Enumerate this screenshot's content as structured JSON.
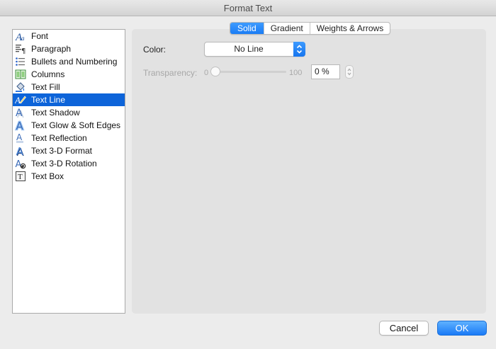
{
  "window": {
    "title": "Format Text"
  },
  "sidebar": {
    "items": [
      {
        "label": "Font",
        "icon": "font-icon",
        "selected": false
      },
      {
        "label": "Paragraph",
        "icon": "paragraph-icon",
        "selected": false
      },
      {
        "label": "Bullets and Numbering",
        "icon": "bullets-icon",
        "selected": false
      },
      {
        "label": "Columns",
        "icon": "columns-icon",
        "selected": false
      },
      {
        "label": "Text Fill",
        "icon": "paint-bucket-icon",
        "selected": false
      },
      {
        "label": "Text Line",
        "icon": "pen-line-icon",
        "selected": true
      },
      {
        "label": "Text Shadow",
        "icon": "text-shadow-icon",
        "selected": false
      },
      {
        "label": "Text Glow & Soft Edges",
        "icon": "text-glow-icon",
        "selected": false
      },
      {
        "label": "Text Reflection",
        "icon": "text-reflection-icon",
        "selected": false
      },
      {
        "label": "Text 3-D Format",
        "icon": "text-3d-format-icon",
        "selected": false
      },
      {
        "label": "Text 3-D Rotation",
        "icon": "text-3d-rotation-icon",
        "selected": false
      },
      {
        "label": "Text Box",
        "icon": "text-box-icon",
        "selected": false
      }
    ]
  },
  "tabs": [
    {
      "label": "Solid",
      "active": true
    },
    {
      "label": "Gradient",
      "active": false
    },
    {
      "label": "Weights & Arrows",
      "active": false
    }
  ],
  "form": {
    "color_label": "Color:",
    "color_value": "No Line",
    "transparency_label": "Transparency:",
    "slider_min": "0",
    "slider_max": "100",
    "transparency_value": "0 %",
    "transparency_fraction": 0
  },
  "buttons": {
    "cancel": "Cancel",
    "ok": "OK"
  },
  "colors": {
    "accent": "#1a7cf5",
    "selection": "#0d64d9"
  }
}
